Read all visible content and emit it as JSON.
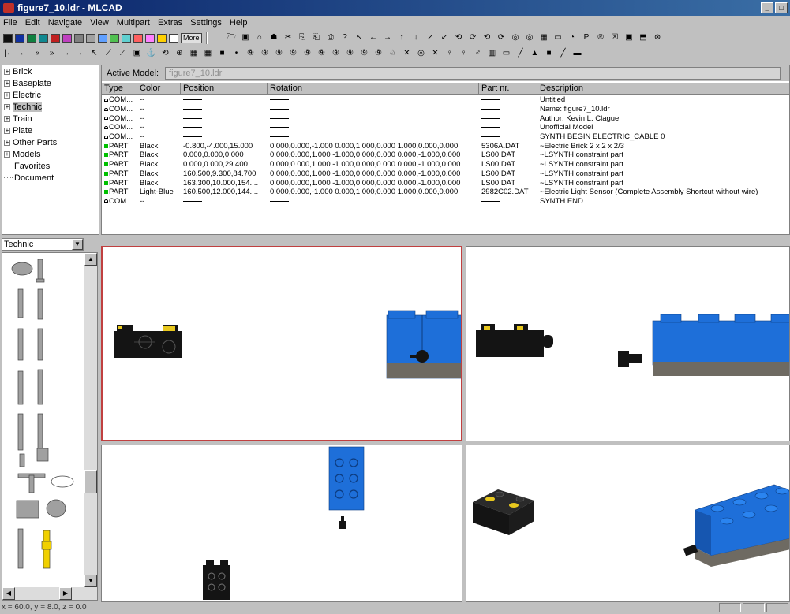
{
  "window": {
    "title": "figure7_10.ldr - MLCAD",
    "min_glyph": "_",
    "restore_glyph": "□"
  },
  "menu": [
    "File",
    "Edit",
    "Navigate",
    "View",
    "Multipart",
    "Extras",
    "Settings",
    "Help"
  ],
  "toolbar": {
    "swatches": [
      "#101010",
      "#1030a0",
      "#108040",
      "#108890",
      "#c02020",
      "#c040c0",
      "#808080",
      "#a0a0a0",
      "#60a0ff",
      "#50c050",
      "#60d0d0",
      "#ff6060",
      "#ff80ff",
      "#ffd000",
      "#ffffff"
    ],
    "more_label": "More",
    "tb1_icons": [
      "□",
      "🗁",
      "▣",
      "⌂",
      "☗",
      "✂",
      "⎘",
      "⎗",
      "⎙",
      "?",
      "↖",
      "←",
      "→",
      "↑",
      "↓",
      "↗",
      "↙",
      "⟲",
      "⟳",
      "⟲",
      "⟳",
      "◎",
      "◎",
      "▦",
      "▭",
      "◔",
      "P",
      "®",
      "☒",
      "▣",
      "⬒",
      "⊗"
    ],
    "tb2_icons": [
      "|←",
      "←",
      "«",
      "»",
      "→",
      "→|",
      "↖",
      "⟋",
      "⟋",
      "▣",
      "⚓",
      "⟲",
      "⊕",
      "▦",
      "▦",
      "■",
      "•",
      "⑨",
      "⑨",
      "⑨",
      "⑨",
      "⑨",
      "⑨",
      "⑨",
      "⑨",
      "⑨",
      "⑨",
      "♘",
      "✕",
      "◎",
      "✕",
      "♀",
      "♀",
      "♂",
      "▥",
      "▭",
      "╱",
      "▲",
      "■",
      "╱",
      "▬"
    ]
  },
  "tree": {
    "items": [
      {
        "label": "Brick",
        "expandable": true
      },
      {
        "label": "Baseplate",
        "expandable": true
      },
      {
        "label": "Electric",
        "expandable": true
      },
      {
        "label": "Technic",
        "expandable": true,
        "selected": true
      },
      {
        "label": "Train",
        "expandable": true
      },
      {
        "label": "Plate",
        "expandable": true
      },
      {
        "label": "Other Parts",
        "expandable": true
      },
      {
        "label": "Models",
        "expandable": true
      },
      {
        "label": "Favorites",
        "expandable": false
      },
      {
        "label": "Document",
        "expandable": false
      }
    ]
  },
  "category_select": {
    "value": "Technic",
    "arrow": "▼"
  },
  "scroll": {
    "up": "▲",
    "down": "▼",
    "left": "◀",
    "right": "▶"
  },
  "active_model": {
    "label": "Active Model:",
    "value": "figure7_10.ldr"
  },
  "table": {
    "headers": [
      "Type",
      "Color",
      "Position",
      "Rotation",
      "Part nr.",
      "Description"
    ],
    "rows": [
      {
        "type": "COM...",
        "kind": "com",
        "color": "--",
        "position": "",
        "rotation": "",
        "part": "",
        "desc": "Untitled"
      },
      {
        "type": "COM...",
        "kind": "com",
        "color": "--",
        "position": "",
        "rotation": "",
        "part": "",
        "desc": "Name: figure7_10.ldr"
      },
      {
        "type": "COM...",
        "kind": "com",
        "color": "--",
        "position": "",
        "rotation": "",
        "part": "",
        "desc": "Author: Kevin L. Clague"
      },
      {
        "type": "COM...",
        "kind": "com",
        "color": "--",
        "position": "",
        "rotation": "",
        "part": "",
        "desc": "Unofficial Model"
      },
      {
        "type": "COM...",
        "kind": "com",
        "color": "--",
        "position": "",
        "rotation": "",
        "part": "",
        "desc": "SYNTH BEGIN ELECTRIC_CABLE 0"
      },
      {
        "type": "PART",
        "kind": "part",
        "color": "Black",
        "position": "-0.800,-4.000,15.000",
        "rotation": "0.000,0.000,-1.000 0.000,1.000,0.000 1.000,0.000,0.000",
        "part": "5306A.DAT",
        "desc": "~Electric Brick 2 x 2 x 2/3"
      },
      {
        "type": "PART",
        "kind": "part",
        "color": "Black",
        "position": "0.000,0.000,0.000",
        "rotation": "0.000,0.000,1.000 -1.000,0.000,0.000 0.000,-1.000,0.000",
        "part": "LS00.DAT",
        "desc": "~LSYNTH constraint part"
      },
      {
        "type": "PART",
        "kind": "part",
        "color": "Black",
        "position": "0.000,0.000,29.400",
        "rotation": "0.000,0.000,1.000 -1.000,0.000,0.000 0.000,-1.000,0.000",
        "part": "LS00.DAT",
        "desc": "~LSYNTH constraint part"
      },
      {
        "type": "PART",
        "kind": "part",
        "color": "Black",
        "position": "160.500,9.300,84.700",
        "rotation": "0.000,0.000,1.000 -1.000,0.000,0.000 0.000,-1.000,0.000",
        "part": "LS00.DAT",
        "desc": "~LSYNTH constraint part"
      },
      {
        "type": "PART",
        "kind": "part",
        "color": "Black",
        "position": "163.300,10.000,154....",
        "rotation": "0.000,0.000,1.000 -1.000,0.000,0.000 0.000,-1.000,0.000",
        "part": "LS00.DAT",
        "desc": "~LSYNTH constraint part"
      },
      {
        "type": "PART",
        "kind": "part",
        "color": "Light-Blue",
        "position": "160.500,12.000,144....",
        "rotation": "0.000,0.000,-1.000 0.000,1.000,0.000 1.000,0.000,0.000",
        "part": "2982C02.DAT",
        "desc": "~Electric Light Sensor (Complete Assembly Shortcut without wire)"
      },
      {
        "type": "COM...",
        "kind": "com",
        "color": "--",
        "position": "",
        "rotation": "",
        "part": "",
        "desc": "SYNTH END"
      }
    ]
  },
  "colors": {
    "lego_blue": "#1e6fd9",
    "lego_black": "#141414",
    "lego_gray": "#6e6a62",
    "lego_yellow": "#e8c81e",
    "selected_view_border": "#c04040",
    "title_start": "#0a246a",
    "title_end": "#3a6ea5"
  },
  "status": {
    "coords": "x = 60.0, y = 8.0, z = 0.0"
  }
}
